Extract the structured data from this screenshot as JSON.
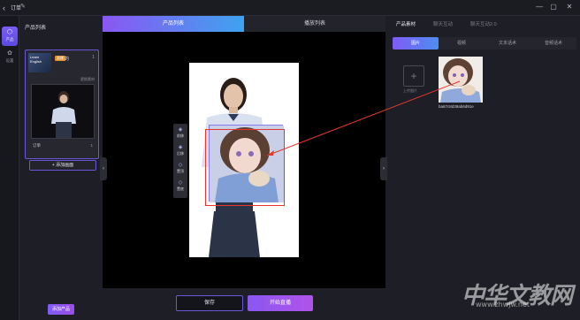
{
  "titlebar": {
    "back_icon": "chevron-left-icon",
    "title": "订单",
    "edit_icon": "pencil-icon",
    "min_glyph": "—",
    "max_glyph": "▢",
    "close_glyph": "✕"
  },
  "rail": {
    "items": [
      {
        "label": "产品",
        "icon": "gear-hex-icon"
      },
      {
        "label": "设置",
        "icon": "settings-icon"
      }
    ]
  },
  "product_list": {
    "header": "产品列表",
    "card": {
      "thumb_text": "Learn English",
      "tag": "直播",
      "name": "的",
      "count": "1",
      "link": "更换素材",
      "video_label": "订单",
      "video_count": "1"
    },
    "add_script_label": "+  添加画面",
    "add_product_label": "添加产品"
  },
  "center": {
    "tabs": [
      "产品列表",
      "播放列表"
    ],
    "tools": [
      {
        "icon": "layer-up-icon",
        "label": "前移"
      },
      {
        "icon": "layer-down-icon",
        "label": "后移"
      },
      {
        "icon": "top-layer-icon",
        "label": "置顶"
      },
      {
        "icon": "bottom-layer-icon",
        "label": "置底"
      }
    ],
    "save_label": "保存",
    "live_label": "开始直播"
  },
  "right": {
    "tabs": [
      "产品素材",
      "聊天互动",
      "聊天互动2.0"
    ],
    "subtabs": [
      "图片",
      "视频",
      "文本话术",
      "音频话术"
    ],
    "upload_label": "上传图片",
    "material_name": "ba67c8d39ab6d91e"
  },
  "watermark": {
    "brand": "中华文教网",
    "url": "www.zhwjw.net"
  },
  "colors": {
    "accent": "#7d5cf6",
    "highlight": "#e6372e",
    "background": "#1e1f26"
  }
}
